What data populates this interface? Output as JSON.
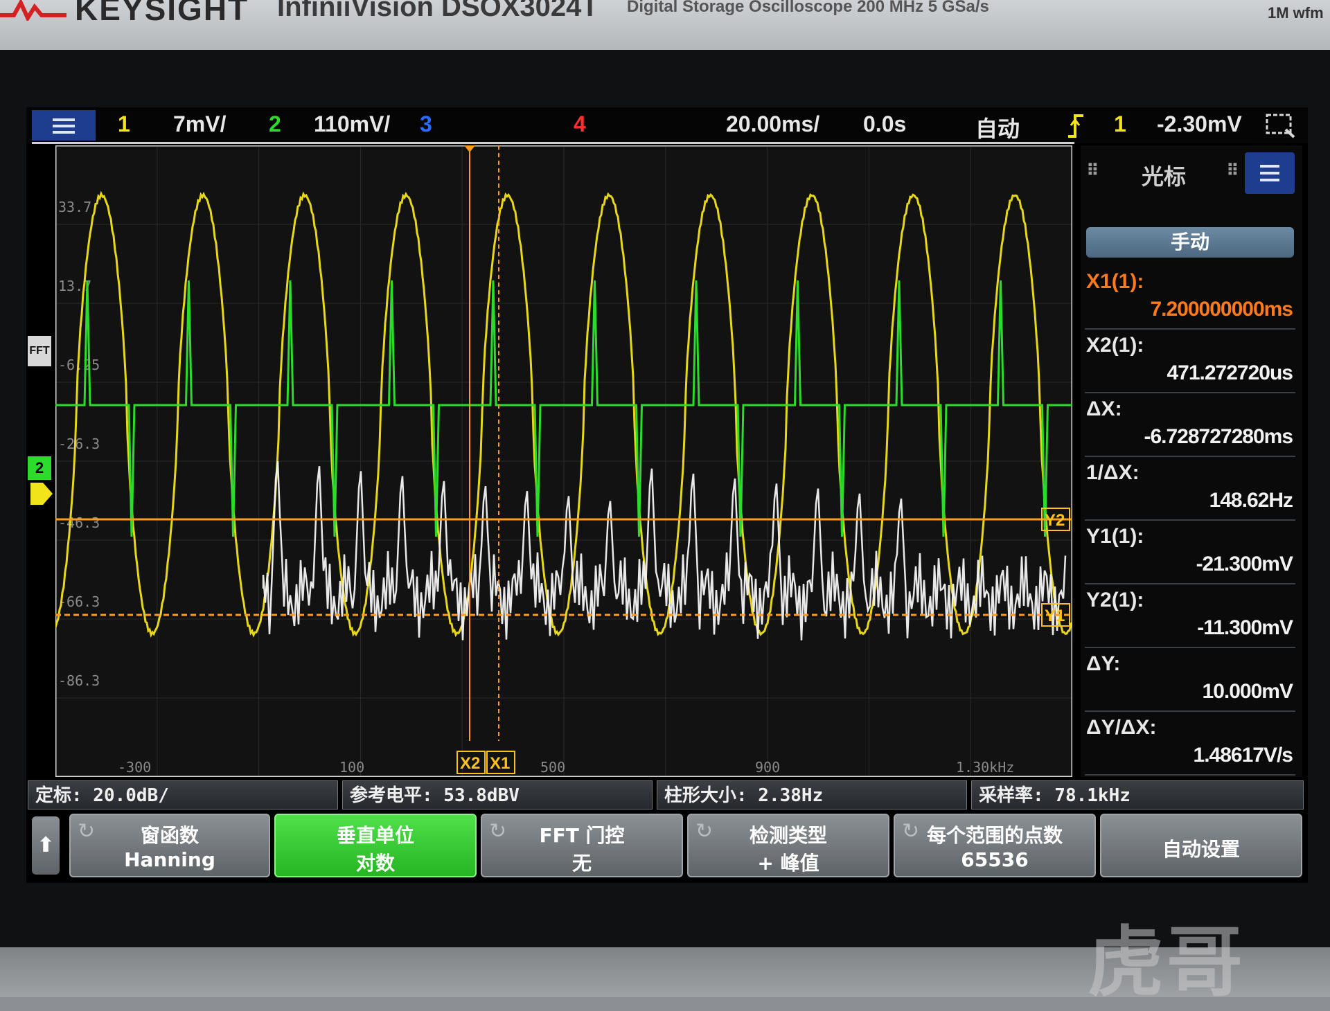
{
  "bezel": {
    "brand": "KEYSIGHT",
    "model": "InfiniiVision DSOX3024T",
    "model_sub": "Digital Storage Oscilloscope   200 MHz   5 GSa/s",
    "wfm": "1M wfm",
    "watermark": "虎哥"
  },
  "topbar": {
    "ch1_num": "1",
    "ch1_scale": "7mV/",
    "ch2_num": "2",
    "ch2_scale": "110mV/",
    "ch3_num": "3",
    "ch4_num": "4",
    "timebase": "20.00ms/",
    "delay": "0.0s",
    "trigger_mode": "自动",
    "trigger_source": "1",
    "trigger_level": "-2.30mV"
  },
  "graticule": {
    "y_labels": [
      "33.7",
      "13.7",
      "-6.25",
      "-26.3",
      "-46.3",
      "-66.3",
      "-86.3"
    ],
    "x_labels": [
      "-300",
      "100",
      "500",
      "900",
      "1.30kHz"
    ],
    "fft_marker": "FFT",
    "ch2_marker": "2",
    "cursor_labels": {
      "x1": "X1",
      "x2": "X2",
      "y1": "Y1",
      "y2": "Y2"
    }
  },
  "cursor_panel": {
    "title": "光标",
    "mode": "手动",
    "items": [
      {
        "label": "X1(1):",
        "value": "7.200000000ms",
        "color": "#ff7a1a"
      },
      {
        "label": "X2(1):",
        "value": "471.272720us",
        "color": "#f2f2f2"
      },
      {
        "label": "ΔX:",
        "value": "-6.728727280ms",
        "color": "#f2f2f2"
      },
      {
        "label": "1/ΔX:",
        "value": "148.62Hz",
        "color": "#f2f2f2"
      },
      {
        "label": "Y1(1):",
        "value": "-21.300mV",
        "color": "#f2f2f2"
      },
      {
        "label": "Y2(1):",
        "value": "-11.300mV",
        "color": "#f2f2f2"
      },
      {
        "label": "ΔY:",
        "value": "10.000mV",
        "color": "#f2f2f2"
      },
      {
        "label": "ΔY/ΔX:",
        "value": "1.48617V/s",
        "color": "#f2f2f2"
      }
    ]
  },
  "infobar": {
    "scale": "定标: 20.0dB/",
    "ref_level": "参考电平: 53.8dBV",
    "bin_size": "柱形大小: 2.38Hz",
    "sample_rate": "采样率: 78.1kHz"
  },
  "softkeys": [
    {
      "line1": "窗函数",
      "line2": "Hanning"
    },
    {
      "line1": "垂直单位",
      "line2": "对数"
    },
    {
      "line1": "FFT 门控",
      "line2": "无"
    },
    {
      "line1": "检测类型",
      "line2": "+ 峰值"
    },
    {
      "line1": "每个范围的点数",
      "line2": "65536"
    },
    {
      "line1": "自动设置",
      "line2": ""
    }
  ],
  "colors": {
    "ch1": "#f2e41a",
    "ch2": "#2bdc2b",
    "ch3": "#2b6cff",
    "ch4": "#ff3030",
    "fft": "#f4f4f4",
    "cursor": "#ff9a1a"
  }
}
